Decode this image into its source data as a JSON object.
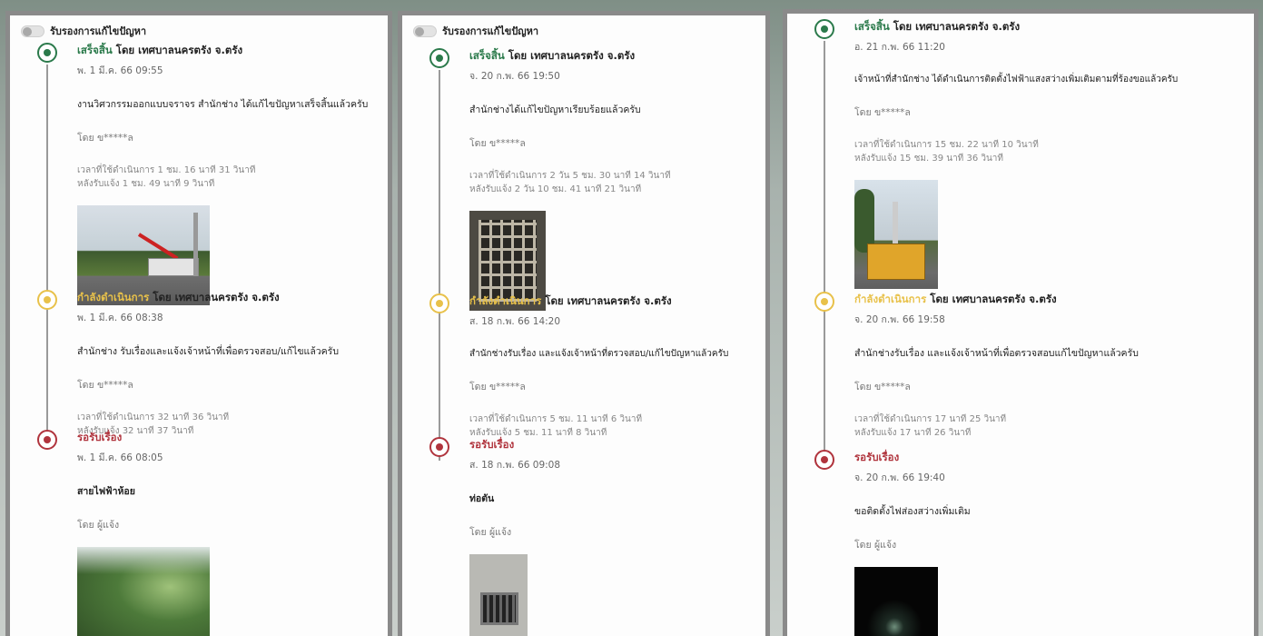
{
  "toggle_label": "รับรองการแก้ไขปัญหา",
  "panels": [
    {
      "entries": [
        {
          "status": "เสร็จสิ้น",
          "agency": "โดย เทศบาลนครตรัง จ.ตรัง",
          "date": "พ. 1 มี.ค. 66 09:55",
          "message": "งานวิศวกรรมออกแบบจราจร สำนักช่าง ได้แก้ไขปัญหาเสร็จสิ้นแล้วครับ",
          "by": "โดย ข*****ล",
          "time_used": "เวลาที่ใช้ดำเนินการ 1 ชม. 16 นาที 31 วินาที",
          "since_report": "หลังรับแจ้ง 1 ชม. 49 นาที 9 วินาที"
        },
        {
          "status": "กำลังดำเนินการ",
          "agency": "โดย เทศบาลนครตรัง จ.ตรัง",
          "date": "พ. 1 มี.ค. 66 08:38",
          "message": "สำนักช่าง รับเรื่องและแจ้งเจ้าหน้าที่เพื่อตรวจสอบ/แก้ไขแล้วครับ",
          "by": "โดย ข*****ล",
          "time_used": "เวลาที่ใช้ดำเนินการ 32 นาที 36 วินาที",
          "since_report": "หลังรับแจ้ง 32 นาที 37 วินาที"
        },
        {
          "status": "รอรับเรื่อง",
          "date": "พ. 1 มี.ค. 66 08:05",
          "message": "สายไฟฟ้าห้อย",
          "by": "โดย ผู้แจ้ง"
        }
      ]
    },
    {
      "entries": [
        {
          "status": "เสร็จสิ้น",
          "agency": "โดย เทศบาลนครตรัง จ.ตรัง",
          "date": "จ. 20 ก.พ. 66 19:50",
          "message": "สำนักช่างได้แก้ไขปัญหาเรียบร้อยแล้วครับ",
          "by": "โดย ข*****ล",
          "time_used": "เวลาที่ใช้ดำเนินการ 2 วัน 5 ชม. 30 นาที 14 วินาที",
          "since_report": "หลังรับแจ้ง 2 วัน 10 ชม. 41 นาที 21 วินาที"
        },
        {
          "status": "กำลังดำเนินการ",
          "agency": "โดย เทศบาลนครตรัง จ.ตรัง",
          "date": "ส. 18 ก.พ. 66 14:20",
          "message": "สำนักช่างรับเรื่อง และแจ้งเจ้าหน้าที่ตรวจสอบ/แก้ไขปัญหาแล้วครับ",
          "by": "โดย ข*****ล",
          "time_used": "เวลาที่ใช้ดำเนินการ 5 ชม. 11 นาที 6 วินาที",
          "since_report": "หลังรับแจ้ง 5 ชม. 11 นาที 8 วินาที"
        },
        {
          "status": "รอรับเรื่อง",
          "date": "ส. 18 ก.พ. 66 09:08",
          "message": "ท่อตัน",
          "by": "โดย ผู้แจ้ง"
        }
      ]
    },
    {
      "entries": [
        {
          "status": "เสร็จสิ้น",
          "agency": "โดย เทศบาลนครตรัง จ.ตรัง",
          "date": "อ. 21 ก.พ. 66 11:20",
          "message": "เจ้าหน้าที่สำนักช่าง ได้ดำเนินการติดตั้งไฟฟ้าแสงสว่างเพิ่มเติมตามที่ร้องขอแล้วครับ",
          "by": "โดย ข*****ล",
          "time_used": "เวลาที่ใช้ดำเนินการ 15 ชม. 22 นาที 10 วินาที",
          "since_report": "หลังรับแจ้ง 15 ชม. 39 นาที 36 วินาที"
        },
        {
          "status": "กำลังดำเนินการ",
          "agency": "โดย เทศบาลนครตรัง จ.ตรัง",
          "date": "จ. 20 ก.พ. 66 19:58",
          "message": "สำนักช่างรับเรื่อง และแจ้งเจ้าหน้าที่เพื่อตรวจสอบแก้ไขปัญหาแล้วครับ",
          "by": "โดย ข*****ล",
          "time_used": "เวลาที่ใช้ดำเนินการ 17 นาที 25 วินาที",
          "since_report": "หลังรับแจ้ง 17 นาที 26 วินาที"
        },
        {
          "status": "รอรับเรื่อง",
          "date": "จ. 20 ก.พ. 66 19:40",
          "message": "ขอติดตั้งไฟส่องสว่างเพิ่มเติม",
          "by": "โดย ผู้แจ้ง"
        }
      ]
    }
  ],
  "colors": {
    "done": "#2b7a4b",
    "in_progress": "#e8c14a",
    "waiting": "#b0343d",
    "panel_border": "#8a8a8a"
  }
}
